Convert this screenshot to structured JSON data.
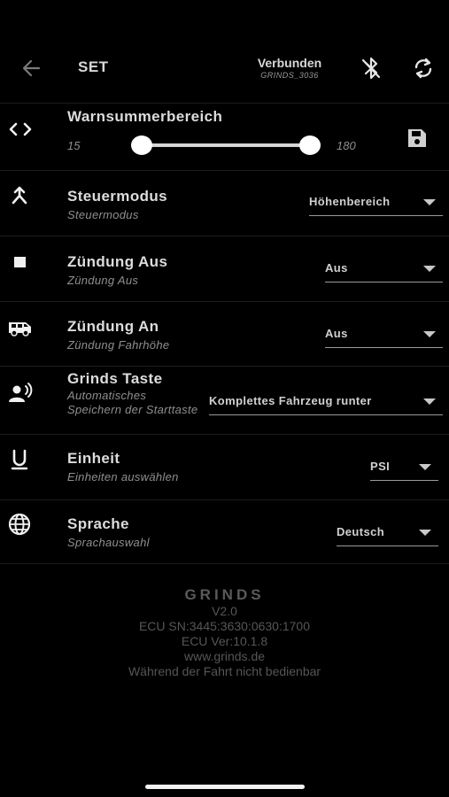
{
  "header": {
    "title": "SET",
    "connection_status": "Verbunden",
    "device_name": "GRINDS_3036",
    "icons": [
      "back-arrow-icon",
      "bluetooth-off-icon",
      "sync-icon"
    ]
  },
  "buzzer_range": {
    "title": "Warnsummerbereich",
    "min_label": "15",
    "max_label": "180",
    "low_value": 15,
    "high_value": 180,
    "icons": [
      "code-icon",
      "save-icon"
    ]
  },
  "settings": [
    {
      "title": "Steuermodus",
      "subtitle": "Steuermodus",
      "value": "Höhenbereich",
      "icon": "merge-arrow-icon"
    },
    {
      "title": "Zündung Aus",
      "subtitle": "Zündung Aus",
      "value": "Aus",
      "icon": "stop-square-icon"
    },
    {
      "title": "Zündung An",
      "subtitle": "Zündung Fahrhöhe",
      "value": "Aus",
      "icon": "van-icon"
    },
    {
      "title": "Grinds Taste",
      "subtitle": "Automatisches Speichern der Starttaste",
      "value": "Komplettes Fahrzeug runter",
      "icon": "voice-person-icon"
    },
    {
      "title": "Einheit",
      "subtitle": "Einheiten auswählen",
      "value": "PSI",
      "icon": "unit-u-icon"
    },
    {
      "title": "Sprache",
      "subtitle": "Sprachauswahl",
      "value": "Deutsch",
      "icon": "globe-icon"
    }
  ],
  "footer": {
    "brand": "GRINDS",
    "version": "V2.0",
    "ecu_sn": "ECU SN:3445:3630:0630:1700",
    "ecu_ver": "ECU Ver:10.1.8",
    "website": "www.grinds.de",
    "notice": "Während der Fahrt nicht bedienbar"
  },
  "colors": {
    "background": "#000000",
    "text": "#dcdcdc",
    "muted": "#8f8f8f"
  }
}
